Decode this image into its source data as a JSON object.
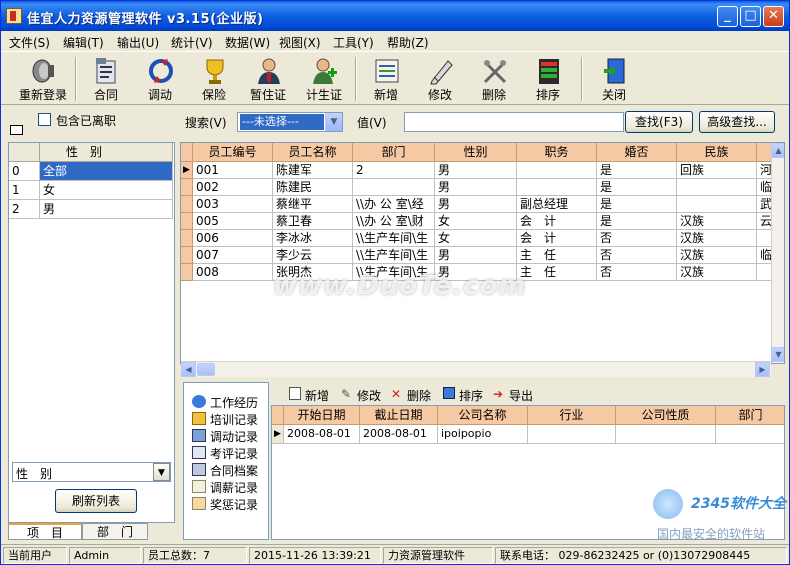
{
  "window": {
    "title": "佳宜人力资源管理软件 v3.15(企业版)",
    "min": "_",
    "max": "□",
    "close": "✕"
  },
  "menu": [
    "文件(S)",
    "编辑(T)",
    "输出(U)",
    "统计(V)",
    "数据(W)",
    "视图(X)",
    "工具(Y)",
    "帮助(Z)"
  ],
  "toolbar": [
    {
      "label": "重新登录",
      "icon": "relogin-icon"
    },
    {
      "label": "合同",
      "icon": "contract-icon"
    },
    {
      "label": "调动",
      "icon": "transfer-icon"
    },
    {
      "label": "保险",
      "icon": "insurance-trophy-icon"
    },
    {
      "label": "暂住证",
      "icon": "residence-permit-icon"
    },
    {
      "label": "计生证",
      "icon": "family-planning-icon"
    },
    {
      "label": "新增",
      "icon": "add-icon"
    },
    {
      "label": "修改",
      "icon": "edit-icon"
    },
    {
      "label": "删除",
      "icon": "delete-icon"
    },
    {
      "label": "排序",
      "icon": "sort-icon"
    },
    {
      "label": "关闭",
      "icon": "close-door-icon"
    }
  ],
  "search": {
    "include_left_label": "包含已离职",
    "search_label": "搜索(V)",
    "field_value": "---未选择---",
    "value_label": "值(V)",
    "value_input": "",
    "find_button": "查找(F3)",
    "advanced_button": "高级查找..."
  },
  "left_panel": {
    "header": "性　别",
    "rows": [
      {
        "idx": "0",
        "label": "全部",
        "selected": true
      },
      {
        "idx": "1",
        "label": "女",
        "selected": false
      },
      {
        "idx": "2",
        "label": "男",
        "selected": false
      }
    ],
    "group_by": "性　别",
    "refresh_button": "刷新列表",
    "tabs": [
      "项　目",
      "部　门"
    ]
  },
  "main_grid": {
    "columns": [
      "员工编号",
      "员工名称",
      "部门",
      "性别",
      "职务",
      "婚否",
      "民族"
    ],
    "rows": [
      [
        "001",
        "陈建军",
        "2",
        "男",
        "",
        "是",
        "回族",
        "河"
      ],
      [
        "002",
        "陈建民",
        "",
        "男",
        "",
        "是",
        "",
        "临"
      ],
      [
        "003",
        "蔡继平",
        "\\\\办 公 室\\经",
        "男",
        "副总经理",
        "是",
        "",
        "武"
      ],
      [
        "005",
        "蔡卫春",
        "\\\\办 公 室\\财",
        "女",
        "会　计",
        "是",
        "汉族",
        "云"
      ],
      [
        "006",
        "李冰冰",
        "\\\\生产车间\\生",
        "女",
        "会　计",
        "否",
        "汉族",
        ""
      ],
      [
        "007",
        "李少云",
        "\\\\生产车间\\生",
        "男",
        "主　任",
        "否",
        "汉族",
        "临"
      ],
      [
        "008",
        "张明杰",
        "\\\\生产车间\\生",
        "男",
        "主　任",
        "否",
        "汉族",
        ""
      ]
    ]
  },
  "records_menu": [
    "工作经历",
    "培训记录",
    "调动记录",
    "考评记录",
    "合同档案",
    "调薪记录",
    "奖惩记录"
  ],
  "sub_toolbar": [
    "新增",
    "修改",
    "删除",
    "排序",
    "导出"
  ],
  "sub_grid": {
    "columns": [
      "开始日期",
      "截止日期",
      "公司名称",
      "行业",
      "公司性质",
      "部门"
    ],
    "rows": [
      [
        "2008-08-01",
        "2008-08-01",
        "ipoipopio",
        "",
        "",
        ""
      ]
    ]
  },
  "statusbar": {
    "user_label": "当前用户",
    "user": "Admin",
    "total": "员工总数：7",
    "datetime": "2015-11-26 13:39:21",
    "app": "力资源管理软件",
    "contact_label": "联系电话：",
    "contact": "029-86232425 or (0)13072908445"
  },
  "watermark": "www.DuoTe.com",
  "corner_logo": {
    "brand": "2345软件大全",
    "sub": "国内最安全的软件站"
  },
  "colors": {
    "header_orange": "#f5c9a3",
    "selection": "#316ac5",
    "titlebar": "#0a5ce4"
  }
}
